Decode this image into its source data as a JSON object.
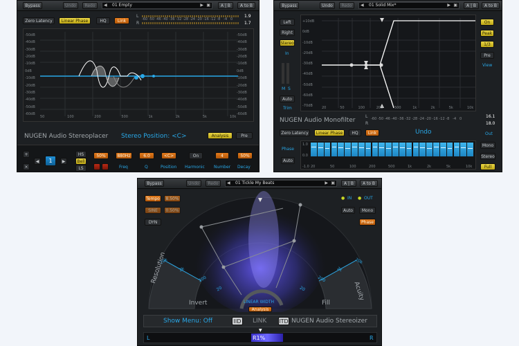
{
  "colors": {
    "accent_yellow": "#e9d545",
    "accent_orange": "#e37b1c",
    "accent_blue": "#29a8e8",
    "panel_bg": "#1d2023"
  },
  "stereoplacer": {
    "toolbar": {
      "bypass": "Bypass",
      "undo": "Undo",
      "redo": "Redo",
      "preset": "01 Empty",
      "ab": "A | B",
      "atob": "A to B"
    },
    "options": {
      "zero_latency": "Zero Latency",
      "linear_phase": "Linear Phase",
      "hq": "HQ",
      "link": "Link"
    },
    "meter": {
      "l_label": "L",
      "r_label": "R",
      "l_value": "1.9",
      "r_value": "1.7",
      "scale": [
        "-60",
        "-50",
        "-46",
        "-40",
        "-36",
        "-32",
        "-28",
        "-24",
        "-20",
        "-16",
        "-12",
        "-8",
        "-4",
        "0"
      ]
    },
    "db_left": [
      "-50dB",
      "-40dB",
      "-30dB",
      "-20dB",
      "-10dB",
      "0dB",
      "-10dB",
      "-20dB",
      "-30dB",
      "-40dB",
      "-50dB",
      "-60dB"
    ],
    "db_right": [
      "-50dB",
      "-40dB",
      "-30dB",
      "-20dB",
      "-10dB",
      "0dB",
      "-10dB",
      "-20dB",
      "-30dB",
      "-40dB",
      "-50dB",
      "-60dB"
    ],
    "freq_labels": [
      "50",
      "100",
      "200",
      "500",
      "1k",
      "2k",
      "5k",
      "10k"
    ],
    "brand": "NUGEN Audio Stereoplacer",
    "position_text": "Stereo Position: <C>",
    "analysis": "Analysis",
    "pre": "Pre",
    "band": {
      "plus": "+",
      "x": "×",
      "prev": "◀",
      "number": "1",
      "next": "▶",
      "hs": "HS",
      "bell": "Bell",
      "ls": "LS",
      "amount": "50%",
      "freq": "880Hz",
      "q": "6.0",
      "position": "<C>",
      "harmonic": "On",
      "number_val": "4",
      "decay": "50%"
    },
    "labels": {
      "freq": "Freq",
      "q": "Q",
      "position": "Position",
      "harmonic": "Harmonic",
      "number": "Number",
      "decay": "Decay"
    }
  },
  "monofilter": {
    "toolbar": {
      "bypass": "Bypass",
      "undo": "Undo",
      "redo": "Redo",
      "preset": "01 Solid Mix*",
      "ab": "A | B",
      "atob": "A to B"
    },
    "side": {
      "left": "Left",
      "right": "Right",
      "stereo": "Stereo",
      "in": "In",
      "m": "M",
      "s": "S",
      "auto": "Auto",
      "trim": "Trim"
    },
    "db_labels": [
      "+10dB",
      "0dB",
      "-10dB",
      "-20dB",
      "-30dB",
      "-40dB",
      "-50dB",
      "-60dB",
      "-70dB"
    ],
    "freq_labels": [
      "20",
      "50",
      "100",
      "200",
      "500",
      "1k",
      "2k",
      "5k",
      "10k"
    ],
    "right": {
      "on": "On",
      "peak": "Peak",
      "third": "1/3",
      "pre": "Pre",
      "view": "View"
    },
    "brand": "NUGEN Audio Monofilter",
    "meter": {
      "l_label": "L",
      "r_label": "R",
      "l_value": "16.1",
      "r_value": "18.0",
      "scale": [
        "-60",
        "-50",
        "-46",
        "-40",
        "-36",
        "-32",
        "-28",
        "-24",
        "-20",
        "-16",
        "-12",
        "-8",
        "-4",
        "0"
      ]
    },
    "options": {
      "zero_latency": "Zero Latency",
      "linear_phase": "Linear Phase",
      "hq": "HQ",
      "link": "Link"
    },
    "undo_title": "Undo",
    "phase": "Phase",
    "auto": "Auto",
    "phase_scale": [
      "1.0",
      "0.0",
      "-1.0"
    ],
    "phase_freq": [
      "20",
      "50",
      "100",
      "200",
      "500",
      "1k",
      "2k",
      "5k",
      "10k"
    ],
    "out": {
      "out": "Out",
      "mono": "Mono",
      "stereo": "Stereo",
      "full": "Full"
    }
  },
  "stereoizer": {
    "toolbar": {
      "bypass": "Bypass",
      "undo": "Undo",
      "redo": "Redo",
      "preset": "01 Tickle My Beats",
      "ab": "A | B",
      "atob": "A to B"
    },
    "left": {
      "tempo": "Tempo",
      "tempo_val": "8.50%",
      "sine": "SINE",
      "sine_val": "0.50%",
      "dyn": "DYN"
    },
    "right": {
      "in": "IN",
      "out": "OUT",
      "auto": "Auto",
      "mono": "Mono",
      "phase": "Phase"
    },
    "arc": {
      "resolution": "Resolution",
      "invert": "Invert",
      "fill": "Fill",
      "acuity": "Acuity",
      "linear_width": "LINEAR WIDTH",
      "analysis": "Analysis",
      "ticks_left": [
        "20k",
        "2k",
        "200",
        "20"
      ],
      "ticks_right": [
        "20",
        "200",
        "2k",
        "20k"
      ]
    },
    "bottom": {
      "show_menu": "Show Menu: Off",
      "iid": "IID",
      "link": "LINK",
      "itd": "ITD",
      "brand": "NUGEN Audio Stereoizer"
    },
    "balance": {
      "l": "L",
      "r": "R",
      "value": "R1%"
    }
  }
}
